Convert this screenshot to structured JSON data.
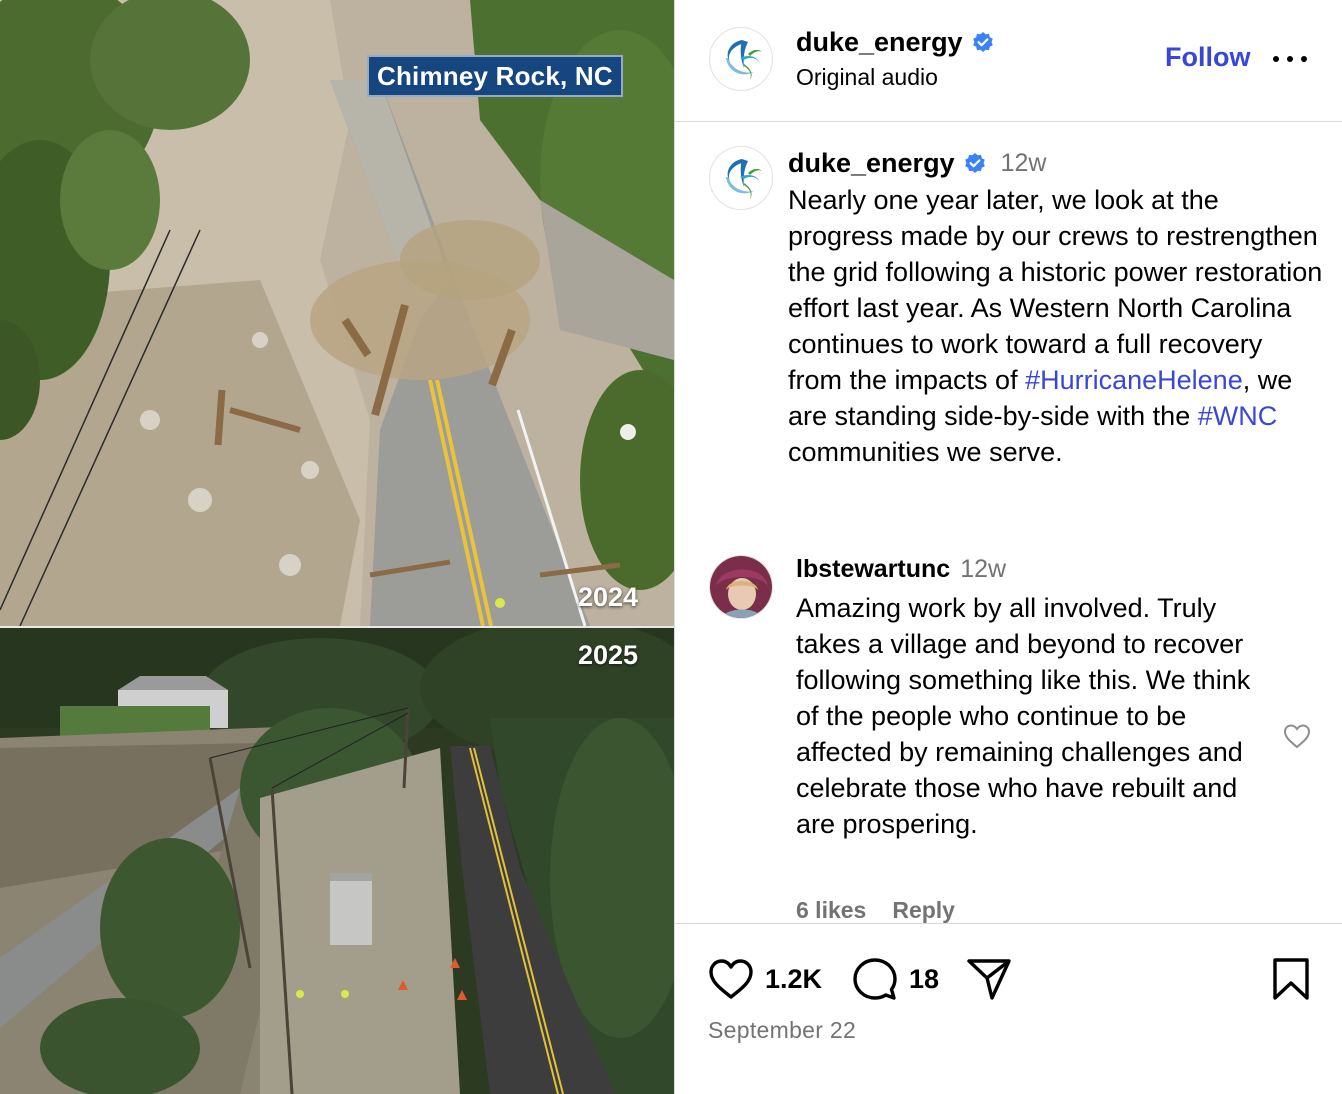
{
  "media": {
    "location_label": "Chimney Rock, NC",
    "year_before": "2024",
    "year_after": "2025"
  },
  "header": {
    "username": "duke_energy",
    "subtext": "Original audio",
    "follow_label": "Follow",
    "verified_icon": "verified-badge-icon",
    "more_icon": "more-options-icon"
  },
  "caption": {
    "username": "duke_energy",
    "time": "12w",
    "text_1": "Nearly one year later, we look at the progress made by our crews to restrengthen the grid following a historic power restoration effort last year. As Western North Carolina continues to work toward a full recovery from the impacts of ",
    "hashtag_1": "#HurricaneHelene",
    "text_2": ", we are standing side-by-side with the ",
    "hashtag_2": "#WNC",
    "text_3": " communities we serve."
  },
  "comment": {
    "username": "lbstewartunc",
    "time": "12w",
    "text": "Amazing work by all involved. Truly takes a village and beyond to recover following something like this. We think of the people who continue to be affected by remaining challenges and celebrate those who have rebuilt and are prospering.",
    "likes": "6 likes",
    "reply_label": "Reply",
    "like_icon": "heart-outline-icon"
  },
  "actions": {
    "likes_count": "1.2K",
    "comments_count": "18",
    "date": "September 22",
    "icons": [
      "heart-icon",
      "comment-bubble-icon",
      "share-send-icon",
      "bookmark-icon"
    ]
  },
  "colors": {
    "link_blue": "#3748d8",
    "verified_blue": "#3b82f6",
    "secondary_gray": "#737373",
    "label_bg": "#15467f"
  }
}
